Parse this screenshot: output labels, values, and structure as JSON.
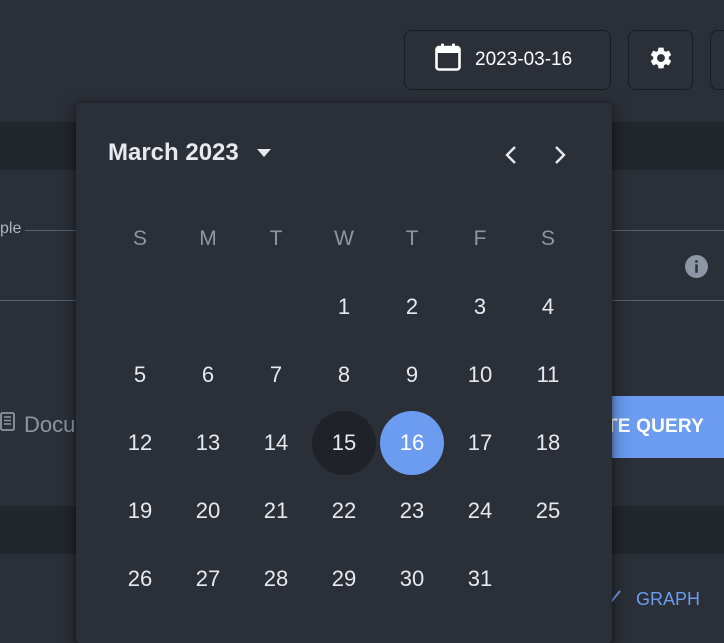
{
  "toolbar": {
    "date_value": "2023-03-16",
    "calendar_icon": "calendar-icon",
    "settings_icon": "gear-icon"
  },
  "background": {
    "field_label_fragment": "ple",
    "documentation_label": "Docu",
    "execute_button_label": "TE QUERY",
    "graph_tab_label": "GRAPH"
  },
  "calendar": {
    "month_label": "March 2023",
    "weekdays": [
      "S",
      "M",
      "T",
      "W",
      "T",
      "F",
      "S"
    ],
    "days": [
      "",
      "",
      "",
      "1",
      "2",
      "3",
      "4",
      "5",
      "6",
      "7",
      "8",
      "9",
      "10",
      "11",
      "12",
      "13",
      "14",
      "15",
      "16",
      "17",
      "18",
      "19",
      "20",
      "21",
      "22",
      "23",
      "24",
      "25",
      "26",
      "27",
      "28",
      "29",
      "30",
      "31",
      ""
    ],
    "today": "15",
    "selected": "16"
  },
  "colors": {
    "accent": "#6b9cf0",
    "surface": "#2b2f37",
    "surface_dark": "#22262d",
    "today_bg": "#1f2228"
  }
}
